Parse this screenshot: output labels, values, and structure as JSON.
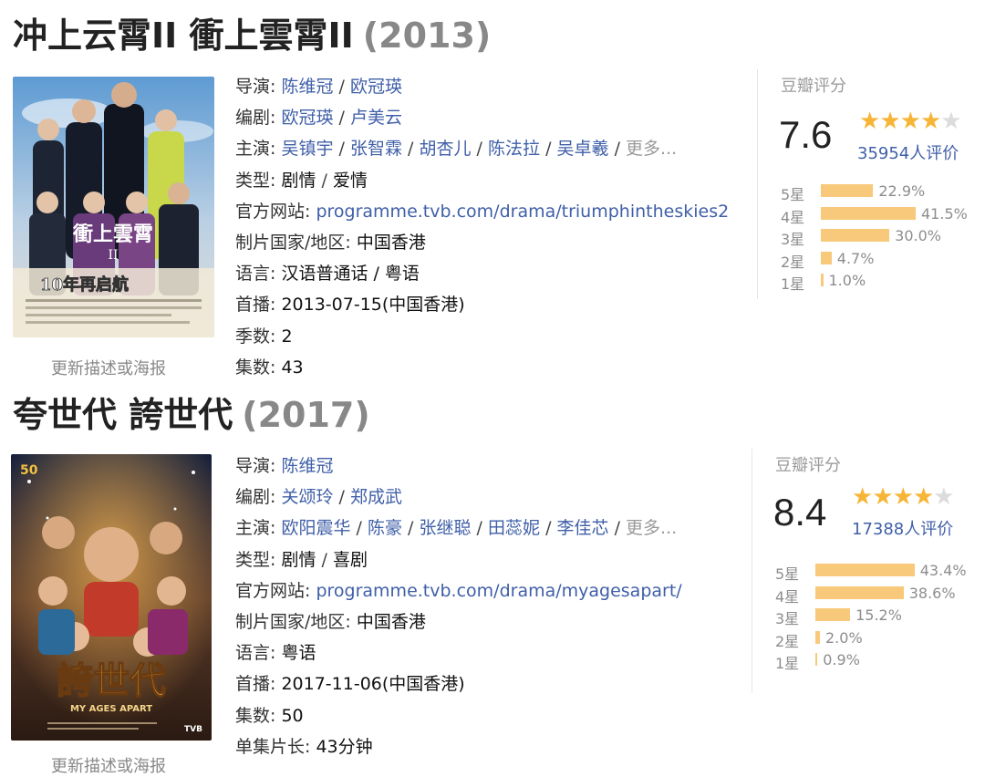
{
  "entries": [
    {
      "title": "冲上云霄II 衝上雲霄II",
      "year": "(2013)",
      "poster": {
        "title_text": "衝上雲霄",
        "sub_text": "II",
        "tagline": "10年再启航",
        "bg_top": "#6da6d8",
        "bg_bottom": "#cfd9e4"
      },
      "poster_caption": "更新描述或海报",
      "info": {
        "director_label": "导演:",
        "directors": [
          "陈维冠",
          "欧冠瑛"
        ],
        "writer_label": "编剧:",
        "writers": [
          "欧冠瑛",
          "卢美云"
        ],
        "cast_label": "主演:",
        "cast": [
          "吴镇宇",
          "张智霖",
          "胡杏儿",
          "陈法拉",
          "吴卓羲"
        ],
        "more": "更多...",
        "genre_label": "类型:",
        "genres": [
          "剧情",
          "爱情"
        ],
        "site_label": "官方网站:",
        "site": "programme.tvb.com/drama/triumphintheskies2",
        "country_label": "制片国家/地区:",
        "country": "中国香港",
        "language_label": "语言:",
        "language": "汉语普通话 / 粤语",
        "premiere_label": "首播:",
        "premiere": "2013-07-15(中国香港)",
        "season_label": "季数:",
        "season": "2",
        "episodes_label": "集数:",
        "episodes": "43"
      },
      "rating": {
        "label": "豆瓣评分",
        "score": "7.6",
        "stars": 4,
        "votes": "35954人评价",
        "distribution": [
          {
            "label": "5星",
            "percent": 22.9,
            "text": "22.9%"
          },
          {
            "label": "4星",
            "percent": 41.5,
            "text": "41.5%"
          },
          {
            "label": "3星",
            "percent": 30.0,
            "text": "30.0%"
          },
          {
            "label": "2星",
            "percent": 4.7,
            "text": "4.7%"
          },
          {
            "label": "1星",
            "percent": 1.0,
            "text": "1.0%"
          }
        ]
      }
    },
    {
      "title": "夸世代 誇世代",
      "year": "(2017)",
      "poster": {
        "title_text": "誇世代",
        "sub_text": "MY AGES APART",
        "badge": "50",
        "brand": "TVB",
        "bg_top": "#1f2a4a",
        "bg_bottom": "#c77a2a"
      },
      "poster_caption": "更新描述或海报",
      "info": {
        "director_label": "导演:",
        "directors": [
          "陈维冠"
        ],
        "writer_label": "编剧:",
        "writers": [
          "关颂玲",
          "郑成武"
        ],
        "cast_label": "主演:",
        "cast": [
          "欧阳震华",
          "陈豪",
          "张继聪",
          "田蕊妮",
          "李佳芯"
        ],
        "more": "更多...",
        "genre_label": "类型:",
        "genres": [
          "剧情",
          "喜剧"
        ],
        "site_label": "官方网站:",
        "site": "programme.tvb.com/drama/myagesapart/",
        "country_label": "制片国家/地区:",
        "country": "中国香港",
        "language_label": "语言:",
        "language": "粤语",
        "premiere_label": "首播:",
        "premiere": "2017-11-06(中国香港)",
        "episodes_label": "集数:",
        "episodes": "50",
        "runtime_label": "单集片长:",
        "runtime": "43分钟"
      },
      "rating": {
        "label": "豆瓣评分",
        "score": "8.4",
        "stars": 4,
        "votes": "17388人评价",
        "distribution": [
          {
            "label": "5星",
            "percent": 43.4,
            "text": "43.4%"
          },
          {
            "label": "4星",
            "percent": 38.6,
            "text": "38.6%"
          },
          {
            "label": "3星",
            "percent": 15.2,
            "text": "15.2%"
          },
          {
            "label": "2星",
            "percent": 2.0,
            "text": "2.0%"
          },
          {
            "label": "1星",
            "percent": 0.9,
            "text": "0.9%"
          }
        ]
      }
    }
  ]
}
